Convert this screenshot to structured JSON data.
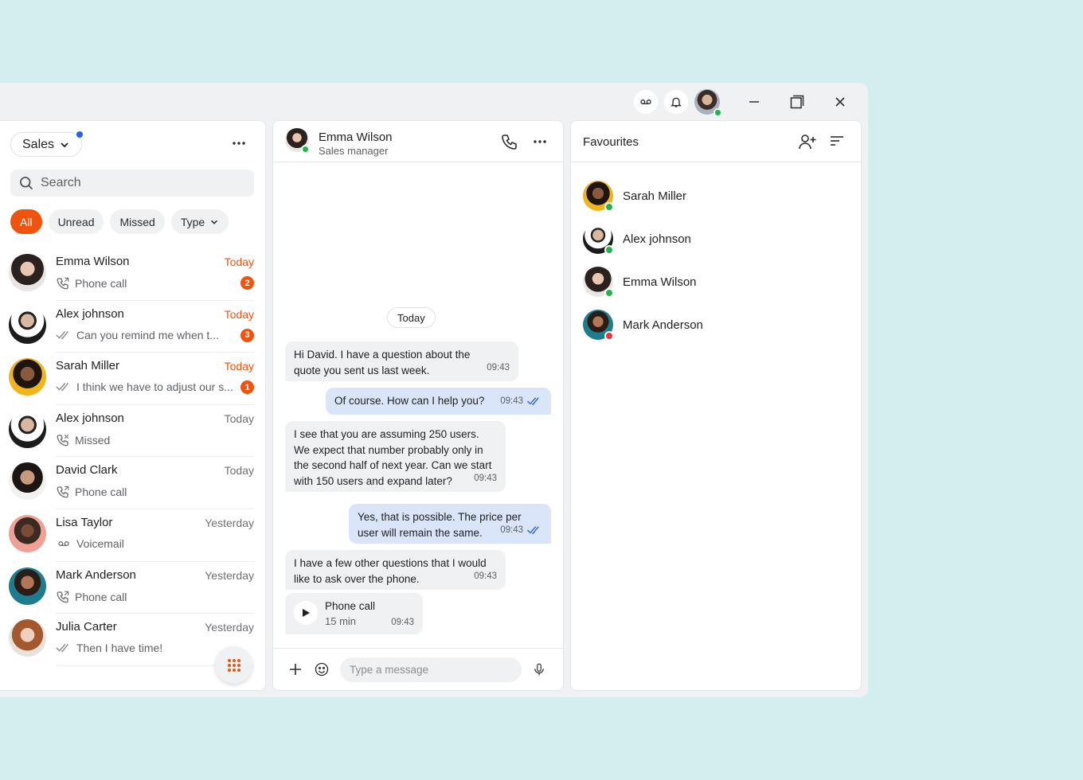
{
  "left": {
    "team": "Sales",
    "search_placeholder": "Search",
    "filters": [
      "All",
      "Unread",
      "Missed",
      "Type"
    ],
    "conversations": [
      {
        "name": "Emma Wilson",
        "time": "Today",
        "time_highlight": true,
        "icon": "phone-call-icon",
        "sub": "Phone call",
        "badge": "2"
      },
      {
        "name": "Alex johnson",
        "time": "Today",
        "time_highlight": true,
        "icon": "double-check-icon",
        "sub": "Can you remind me when t...",
        "badge": "3"
      },
      {
        "name": "Sarah Miller",
        "time": "Today",
        "time_highlight": true,
        "icon": "double-check-icon",
        "sub": "I think we have to adjust our s...",
        "badge": "1"
      },
      {
        "name": "Alex johnson",
        "time": "Today",
        "time_highlight": false,
        "icon": "missed-call-icon",
        "sub": "Missed",
        "badge": ""
      },
      {
        "name": "David Clark",
        "time": "Today",
        "time_highlight": false,
        "icon": "phone-call-icon",
        "sub": "Phone call",
        "badge": ""
      },
      {
        "name": "Lisa Taylor",
        "time": "Yesterday",
        "time_highlight": false,
        "icon": "voicemail-icon",
        "sub": "Voicemail",
        "badge": ""
      },
      {
        "name": "Mark Anderson",
        "time": "Yesterday",
        "time_highlight": false,
        "icon": "phone-call-icon",
        "sub": "Phone call",
        "badge": ""
      },
      {
        "name": "Julia Carter",
        "time": "Yesterday",
        "time_highlight": false,
        "icon": "double-check-icon",
        "sub": "Then I have time!",
        "badge": ""
      }
    ]
  },
  "chat": {
    "contact_name": "Emma Wilson",
    "contact_role": "Sales manager",
    "day_label": "Today",
    "messages": [
      {
        "dir": "in",
        "text": "Hi David. I have a question about the quote you sent us last week.",
        "time": "09:43"
      },
      {
        "dir": "out",
        "text": "Of course. How can I help you?",
        "time": "09:43"
      },
      {
        "dir": "in",
        "text": "I see that you are assuming 250 users. We expect that number probably only in the second half of next year. Can we start with 150 users and expand later?",
        "time": "09:43"
      },
      {
        "dir": "out",
        "text": "Yes, that is possible. The price per user will remain the same.",
        "time": "09:43"
      },
      {
        "dir": "in",
        "text": "I have a few other questions that I would like to ask over the phone.",
        "time": "09:43"
      }
    ],
    "call_bubble": {
      "title": "Phone call",
      "duration": "15 min",
      "time": "09:43"
    },
    "composer_placeholder": "Type a message"
  },
  "favourites": {
    "title": "Favourites",
    "items": [
      {
        "name": "Sarah Miller",
        "status": "online"
      },
      {
        "name": "Alex johnson",
        "status": "online"
      },
      {
        "name": "Emma Wilson",
        "status": "online"
      },
      {
        "name": "Mark Anderson",
        "status": "busy"
      }
    ]
  },
  "colors": {
    "accent": "#f0530d",
    "outgoing_bubble": "#dae5fa",
    "online": "#22b34c",
    "busy": "#e5383b",
    "read_check": "#2a5fd5"
  }
}
